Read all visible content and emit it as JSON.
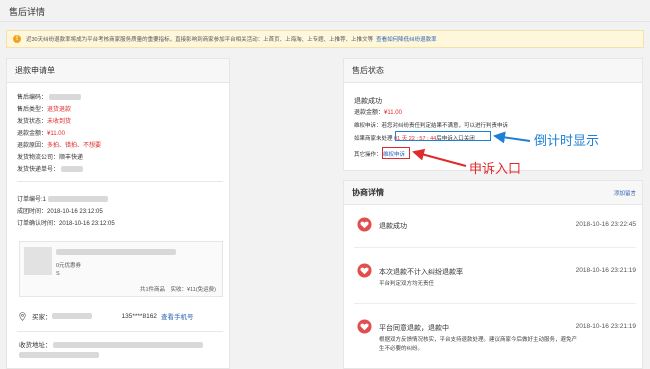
{
  "page": {
    "title": "售后详情"
  },
  "notice": {
    "text": "近30天纠纷退款率将成为平台考核商家服务质量的重要指标，直接影响到商家参加平台相关活动：上首页、上海淘、上专题、上推荐、上推文等",
    "link": "查看如何降低纠纷退款率",
    "color": "#f2a31b"
  },
  "refund_form": {
    "title": "退款申请单",
    "fields": [
      {
        "label": "售后编码：",
        "value": ""
      },
      {
        "label": "售后类型：",
        "value": "退货退款",
        "tone": "red"
      },
      {
        "label": "发货状态：",
        "value": "未收到货",
        "tone": "red"
      },
      {
        "label": "退款金额：",
        "value": "¥11.00",
        "tone": "red"
      },
      {
        "label": "退款原因：",
        "value": "多拍、错拍、不想要",
        "tone": "red"
      },
      {
        "label": "发货物流公司：",
        "value": "顺丰快递"
      },
      {
        "label": "发货快递单号：",
        "value": ""
      }
    ],
    "order_no_label": "订单编号:",
    "order_no_value": "1",
    "created_label": "成团时间：",
    "created_value": "2018-10-16 23:12:05",
    "confirmed_label": "订单确认时间：",
    "confirmed_value": "2018-10-16 23:12:05",
    "product": {
      "note": "0元优惠券",
      "spec": "S",
      "summary": "共1件商品　实收：¥11(免运费)"
    },
    "buyer_label": "买家：",
    "buyer_phone": "135****8162",
    "phone_link": "查看手机号",
    "address_label": "收货地址："
  },
  "after_sale_status": {
    "title": "售后状态",
    "status": "退款成功",
    "amount_label": "退款金额：",
    "amount": "¥11.00",
    "appeal_text": "维权申诉：若您对纠纷责任判定结果不满意，可以进行判责申诉",
    "countdown_prefix": "如果商家未处理",
    "countdown": "01 天 22 : 57 : 44",
    "countdown_suffix": "后申诉入口关闭",
    "other_label": "其它操作：",
    "appeal_button": "维权申诉"
  },
  "negotiation": {
    "title": "协商详情",
    "leave_message": "添加留言",
    "items": [
      {
        "title": "退款成功",
        "time": "2018-10-16 23:22:45",
        "desc": ""
      },
      {
        "title": "本次退款不计入纠纷退款率",
        "time": "2018-10-16 23:21:19",
        "desc": "平台判定双方均无责任"
      },
      {
        "title": "平台同意退款，退款中",
        "time": "2018-10-16 23:21:19",
        "desc": "根据双方反馈情况核实，平台支持退款处理。建议商家今后做好主动服务，避免产生不必要的纠纷。"
      }
    ]
  },
  "annotations": {
    "countdown": "倒计时显示",
    "appeal": "申诉入口"
  },
  "colors": {
    "accent_red": "#e02a2a",
    "link_blue": "#2d64b3",
    "annot_blue": "#1d7fd6"
  },
  "icons": [
    "warning-icon",
    "location-pin-icon",
    "heart-badge-icon"
  ]
}
